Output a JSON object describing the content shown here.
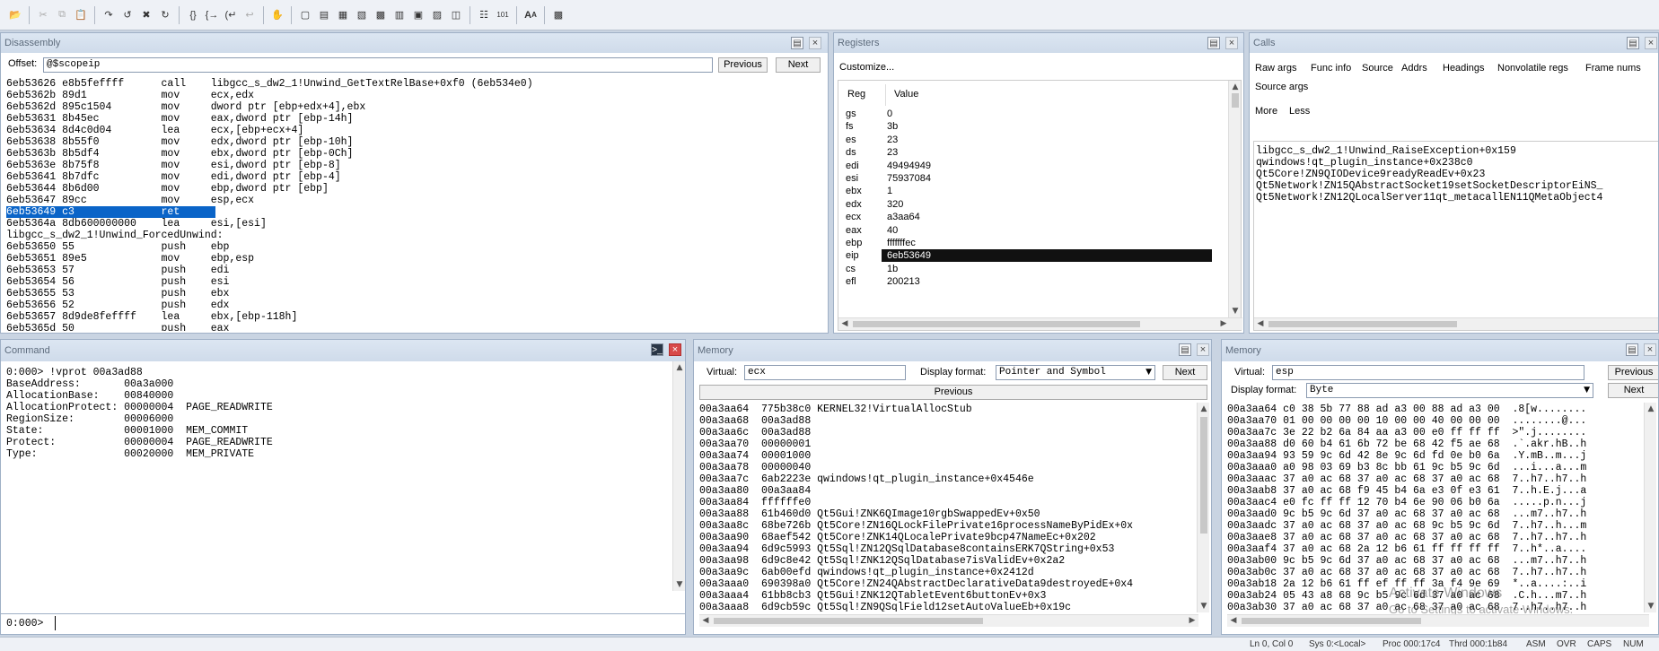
{
  "toolbar": {
    "icons": [
      "open-icon",
      "cut-icon",
      "copy-icon",
      "paste-icon",
      "step-into-icon",
      "step-over-icon",
      "break-icon",
      "restart-icon",
      "step-out-icon",
      "run-to-cursor-icon",
      "return-icon",
      "go-up-icon",
      "hand-icon",
      "command-window-icon",
      "watch-window-icon",
      "locals-window-icon",
      "registers-window-icon",
      "memory-window-icon",
      "callstack-window-icon",
      "disassembly-window-icon",
      "scratch-pad-icon",
      "processes-icon",
      "source-mode-icon",
      "hex-mode-icon",
      "font-icon",
      "options-icon"
    ]
  },
  "disassembly": {
    "title": "Disassembly",
    "offset_label": "Offset:",
    "offset_value": "@$scopeip",
    "previous": "Previous",
    "next": "Next",
    "lines": [
      "6eb53626 e8b5feffff      call    libgcc_s_dw2_1!Unwind_GetTextRelBase+0xf0 (6eb534e0)",
      "6eb5362b 89d1            mov     ecx,edx",
      "6eb5362d 895c1504        mov     dword ptr [ebp+edx+4],ebx",
      "6eb53631 8b45ec          mov     eax,dword ptr [ebp-14h]",
      "6eb53634 8d4c0d04        lea     ecx,[ebp+ecx+4]",
      "6eb53638 8b55f0          mov     edx,dword ptr [ebp-10h]",
      "6eb5363b 8b5df4          mov     ebx,dword ptr [ebp-0Ch]",
      "6eb5363e 8b75f8          mov     esi,dword ptr [ebp-8]",
      "6eb53641 8b7dfc          mov     edi,dword ptr [ebp-4]",
      "6eb53644 8b6d00          mov     ebp,dword ptr [ebp]",
      "6eb53647 89cc            mov     esp,ecx",
      "6eb53649 c3              ret",
      "6eb5364a 8db600000000    lea     esi,[esi]",
      "libgcc_s_dw2_1!Unwind_ForcedUnwind:",
      "6eb53650 55              push    ebp",
      "6eb53651 89e5            mov     ebp,esp",
      "6eb53653 57              push    edi",
      "6eb53654 56              push    esi",
      "6eb53655 53              push    ebx",
      "6eb53656 52              push    edx",
      "6eb53657 8d9de8feffff    lea     ebx,[ebp-118h]",
      "6eb5365d 50              push    eax"
    ]
  },
  "registers": {
    "title": "Registers",
    "customize": "Customize...",
    "col_reg": "Reg",
    "col_value": "Value",
    "rows": [
      {
        "reg": "gs",
        "value": "0"
      },
      {
        "reg": "fs",
        "value": "3b"
      },
      {
        "reg": "es",
        "value": "23"
      },
      {
        "reg": "ds",
        "value": "23"
      },
      {
        "reg": "edi",
        "value": "49494949"
      },
      {
        "reg": "esi",
        "value": "75937084"
      },
      {
        "reg": "ebx",
        "value": "1"
      },
      {
        "reg": "edx",
        "value": "320"
      },
      {
        "reg": "ecx",
        "value": "a3aa64"
      },
      {
        "reg": "eax",
        "value": "40"
      },
      {
        "reg": "ebp",
        "value": "fffffffec"
      },
      {
        "reg": "eip",
        "value": "6eb53649"
      },
      {
        "reg": "cs",
        "value": "1b"
      },
      {
        "reg": "efl",
        "value": "200213"
      }
    ]
  },
  "calls": {
    "title": "Calls",
    "options": [
      "Raw args",
      "Func info",
      "Source",
      "Addrs",
      "Headings",
      "Nonvolatile regs",
      "Frame nums",
      "Source args",
      "More",
      "Less"
    ],
    "frames": [
      "libgcc_s_dw2_1!Unwind_RaiseException+0x159",
      "qwindows!qt_plugin_instance+0x238c0",
      "Qt5Core!ZN9QIODevice9readyReadEv+0x23",
      "Qt5Network!ZN15QAbstractSocket19setSocketDescriptorEiNS_",
      "Qt5Network!ZN12QLocalServer11qt_metacallEN11QMetaObject4"
    ]
  },
  "command": {
    "title": "Command",
    "lines": [
      "0:000> !vprot 00a3ad88",
      "BaseAddress:       00a3a000",
      "AllocationBase:    00840000",
      "AllocationProtect: 00000004  PAGE_READWRITE",
      "RegionSize:        00006000",
      "State:             00001000  MEM_COMMIT",
      "Protect:           00000004  PAGE_READWRITE",
      "Type:              00020000  MEM_PRIVATE"
    ],
    "prompt": "0:000>"
  },
  "memory1": {
    "title": "Memory",
    "virtual_label": "Virtual:",
    "virtual_value": "ecx",
    "format_label": "Display format:",
    "format_value": "Pointer and Symbol",
    "next": "Next",
    "previous": "Previous",
    "lines": [
      "00a3aa64  775b38c0 KERNEL32!VirtualAllocStub",
      "00a3aa68  00a3ad88",
      "00a3aa6c  00a3ad88",
      "00a3aa70  00000001",
      "00a3aa74  00001000",
      "00a3aa78  00000040",
      "00a3aa7c  6ab2223e qwindows!qt_plugin_instance+0x4546e",
      "00a3aa80  00a3aa84",
      "00a3aa84  ffffffe0",
      "00a3aa88  61b460d0 Qt5Gui!ZNK6QImage10rgbSwappedEv+0x50",
      "00a3aa8c  68be726b Qt5Core!ZN16QLockFilePrivate16processNameByPidEx+0x",
      "00a3aa90  68aef542 Qt5Core!ZNK14QLocalePrivate9bcp47NameEc+0x202",
      "00a3aa94  6d9c5993 Qt5Sql!ZN12QSqlDatabase8containsERK7QString+0x53",
      "00a3aa98  6d9c8e42 Qt5Sql!ZNK12QSqlDatabase7isValidEv+0x2a2",
      "00a3aa9c  6ab00efd qwindows!qt_plugin_instance+0x2412d",
      "00a3aaa0  690398a0 Qt5Core!ZN24QAbstractDeclarativeData9destroyedE+0x4",
      "00a3aaa4  61bb8cb3 Qt5Gui!ZNK12QTabletEvent6buttonEv+0x3",
      "00a3aaa8  6d9cb59c Qt5Sql!ZN9QSqlField12setAutoValueEb+0x19c"
    ]
  },
  "memory2": {
    "title": "Memory",
    "virtual_label": "Virtual:",
    "virtual_value": "esp",
    "format_label": "Display format:",
    "format_value": "Byte",
    "previous": "Previous",
    "next": "Next",
    "lines": [
      "00a3aa64 c0 38 5b 77 88 ad a3 00 88 ad a3 00  .8[w........",
      "00a3aa70 01 00 00 00 00 10 00 00 40 00 00 00  ........@...",
      "00a3aa7c 3e 22 b2 6a 84 aa a3 00 e0 ff ff ff  >\".j........",
      "00a3aa88 d0 60 b4 61 6b 72 be 68 42 f5 ae 68  .`.akr.hB..h",
      "00a3aa94 93 59 9c 6d 42 8e 9c 6d fd 0e b0 6a  .Y.mB..m...j",
      "00a3aaa0 a0 98 03 69 b3 8c bb 61 9c b5 9c 6d  ...i...a...m",
      "00a3aaac 37 a0 ac 68 37 a0 ac 68 37 a0 ac 68  7..h7..h7..h",
      "00a3aab8 37 a0 ac 68 f9 45 b4 6a e3 0f e3 61  7..h.E.j...a",
      "00a3aac4 e0 fc ff ff 12 70 b4 6e 90 06 b0 6a  .....p.n...j",
      "00a3aad0 9c b5 9c 6d 37 a0 ac 68 37 a0 ac 68  ...m7..h7..h",
      "00a3aadc 37 a0 ac 68 37 a0 ac 68 9c b5 9c 6d  7..h7..h...m",
      "00a3aae8 37 a0 ac 68 37 a0 ac 68 37 a0 ac 68  7..h7..h7..h",
      "00a3aaf4 37 a0 ac 68 2a 12 b6 61 ff ff ff ff  7..h*..a....",
      "00a3ab00 9c b5 9c 6d 37 a0 ac 68 37 a0 ac 68  ...m7..h7..h",
      "00a3ab0c 37 a0 ac 68 37 a0 ac 68 37 a0 ac 68  7..h7..h7..h",
      "00a3ab18 2a 12 b6 61 ff ef ff ff 3a f4 9e 69  *..a....:..i",
      "00a3ab24 05 43 a8 68 9c b5 9c 6d 37 a0 ac 68  .C.h...m7..h",
      "00a3ab30 37 a0 ac 68 37 a0 ac 68 37 a0 ac 68  7..h7..h7..h"
    ],
    "watermark1": "Activate Windows",
    "watermark2": "Go to Settings to activate Windows."
  },
  "status": {
    "ln_col": "Ln 0, Col 0",
    "sys": "Sys 0:<Local>",
    "proc": "Proc 000:17c4",
    "thrd": "Thrd 000:1b84",
    "asm": "ASM",
    "ovr": "OVR",
    "caps": "CAPS",
    "num": "NUM"
  }
}
